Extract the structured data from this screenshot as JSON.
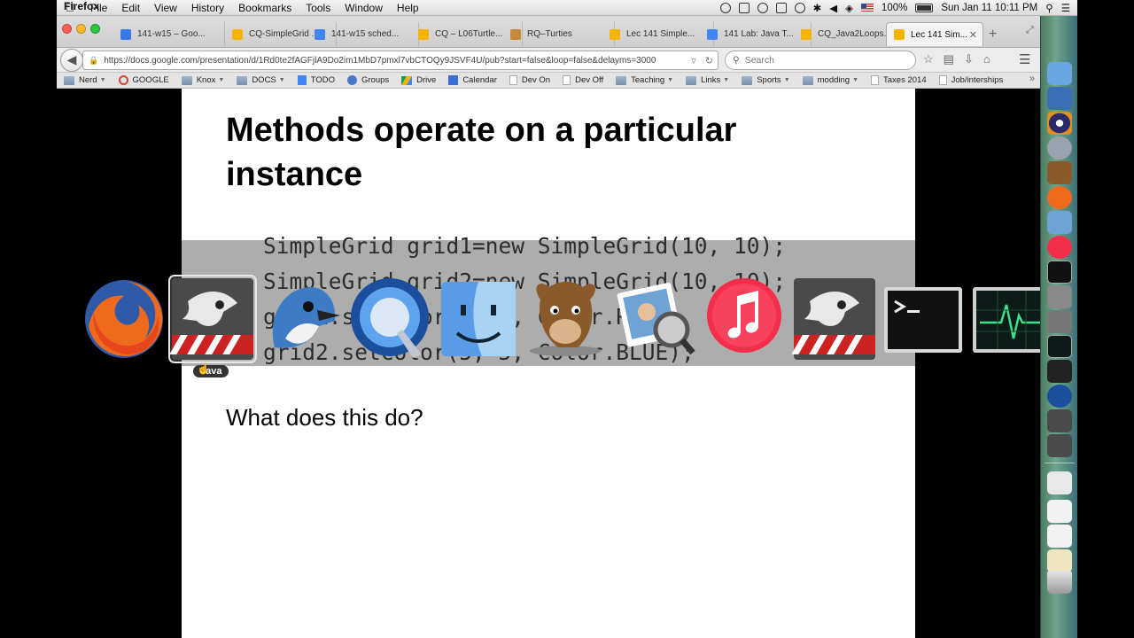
{
  "menubar": {
    "apple": "",
    "app_name": "Firefox",
    "menus": [
      "File",
      "Edit",
      "View",
      "History",
      "Bookmarks",
      "Tools",
      "Window",
      "Help"
    ],
    "battery": "100%",
    "clock": "Sun Jan 11  10:11 PM"
  },
  "tabs": [
    {
      "label": "141-w15 – Goo...",
      "color": "#3b78e7"
    },
    {
      "label": "CQ-SimpleGrid ...",
      "color": "#f4b400"
    },
    {
      "label": "141-w15 sched...",
      "color": "#4285f4"
    },
    {
      "label": "CQ – L06Turtle...",
      "color": "#f4b400"
    },
    {
      "label": "RQ–Turties",
      "color": "#c4893a"
    },
    {
      "label": "Lec 141 Simple...",
      "color": "#f4b400"
    },
    {
      "label": "141 Lab: Java T...",
      "color": "#4285f4"
    },
    {
      "label": "CQ_Java2Loops...",
      "color": "#f4b400"
    },
    {
      "label": "Lec 141 Sim...",
      "color": "#f4b400"
    }
  ],
  "navbar": {
    "url": "https://docs.google.com/presentation/d/1Rd0te2fAGFjlA9Do2im1MbD7pmxl7vbCTOQy9JSVF4U/pub?start=false&loop=false&delayms=3000",
    "search_placeholder": "Search"
  },
  "bookmarks": [
    {
      "label": "Nerd",
      "type": "folder",
      "caret": true
    },
    {
      "label": "GOOGLE",
      "type": "google"
    },
    {
      "label": "Knox",
      "type": "folder",
      "caret": true
    },
    {
      "label": "DOCS",
      "type": "folder",
      "caret": true
    },
    {
      "label": "TODO",
      "type": "docs"
    },
    {
      "label": "Groups",
      "type": "groups"
    },
    {
      "label": "Drive",
      "type": "drive"
    },
    {
      "label": "Calendar",
      "type": "calendar"
    },
    {
      "label": "Dev On",
      "type": "page"
    },
    {
      "label": "Dev Off",
      "type": "page"
    },
    {
      "label": "Teaching",
      "type": "folder",
      "caret": true
    },
    {
      "label": "Links",
      "type": "folder",
      "caret": true
    },
    {
      "label": "Sports",
      "type": "folder",
      "caret": true
    },
    {
      "label": "modding",
      "type": "folder",
      "caret": true
    },
    {
      "label": "Taxes 2014",
      "type": "page"
    },
    {
      "label": "Job/interships",
      "type": "page"
    }
  ],
  "slide": {
    "title": "Methods operate on a particular instance",
    "code": "SimpleGrid grid1=new SimpleGrid(10, 10);\nSimpleGrid grid2=new SimpleGrid(10, 10);\ngrid1.setColor(1, 1, Color.RED);\ngrid2.setColor(5, 5, Color.BLUE);",
    "question": "What does this do?"
  },
  "switcher": {
    "selected_label": "Java",
    "apps": [
      "firefox-icon",
      "java-icon",
      "cyberduck-icon",
      "quicktime-icon",
      "finder-icon",
      "gimp-icon",
      "preview-icon",
      "itunes-icon",
      "java-icon",
      "terminal-icon",
      "activity-monitor-icon"
    ]
  }
}
